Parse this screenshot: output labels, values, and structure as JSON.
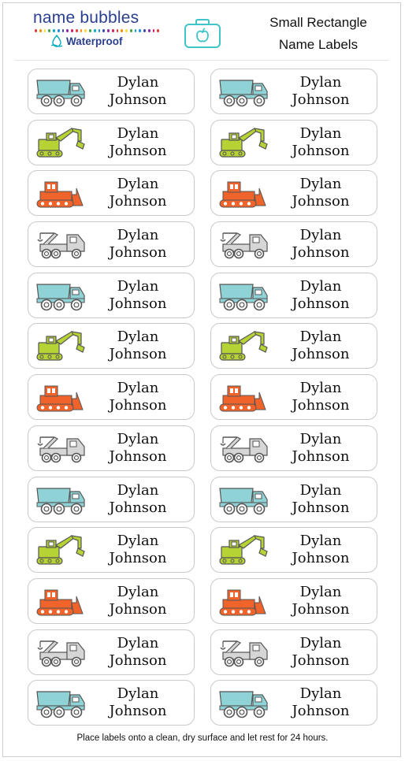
{
  "brand": {
    "name": "name bubbles",
    "waterproof": "Waterproof",
    "dot_colors": [
      "#e53935",
      "#fb8c00",
      "#fdd835",
      "#43a047",
      "#00acc1",
      "#1e88e5",
      "#3949ab",
      "#8e24aa",
      "#d81b60",
      "#e53935",
      "#fb8c00",
      "#fdd835",
      "#43a047",
      "#00acc1",
      "#1e88e5",
      "#3949ab",
      "#8e24aa",
      "#d81b60",
      "#e53935",
      "#fb8c00",
      "#fdd835",
      "#43a047",
      "#00acc1",
      "#1e88e5",
      "#3949ab",
      "#8e24aa",
      "#d81b60",
      "#e53935"
    ]
  },
  "lunchbox_icon": "lunchbox-apple-icon",
  "title": {
    "line1": "Small Rectangle",
    "line2": "Name Labels"
  },
  "label_name": {
    "first": "Dylan",
    "last": "Johnson"
  },
  "vehicle_cycle": [
    "dump-truck",
    "excavator",
    "bulldozer",
    "tow-truck"
  ],
  "vehicle_colors": {
    "dump-truck": "#8fd3d6",
    "excavator": "#b5d334",
    "bulldozer": "#f0632a",
    "tow-truck": "#d6d6d6"
  },
  "rows": 13,
  "footer": "Place labels onto a clean, dry surface and let rest for 24 hours."
}
